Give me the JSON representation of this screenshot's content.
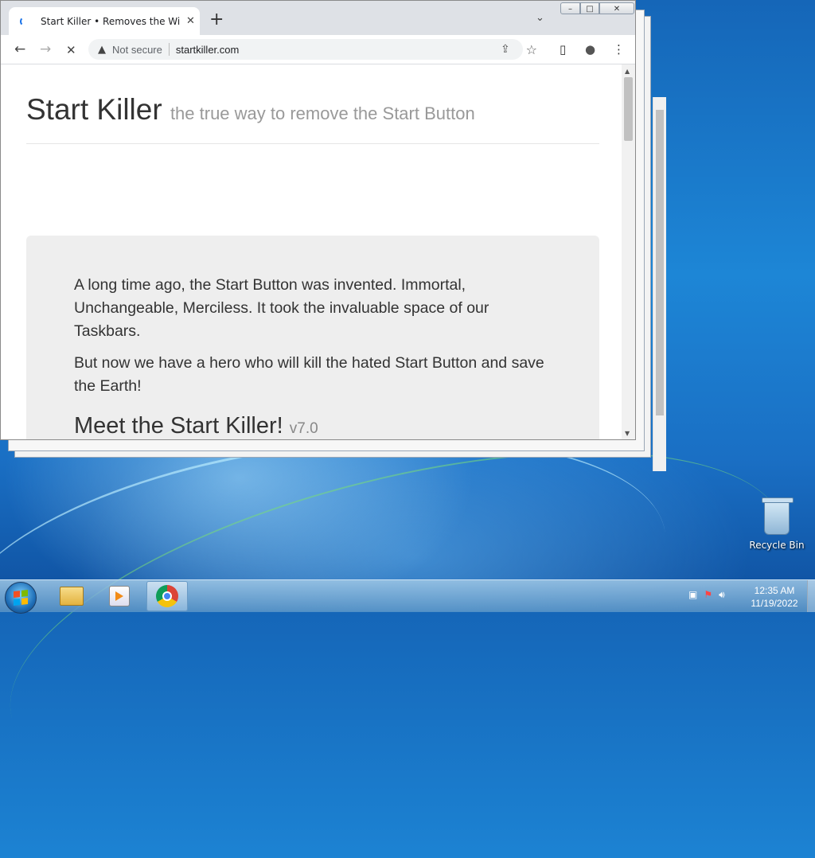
{
  "browser": {
    "tab_title": "Start Killer • Removes the Windows Start Button",
    "tab_close": "✕",
    "new_tab": "+",
    "tab_search": "⌄",
    "window_controls": {
      "minimize": "–",
      "maximize": "□",
      "close": "✕"
    },
    "nav": {
      "back": "←",
      "forward": "→",
      "reload": "✕"
    },
    "security_label": "Not secure",
    "url": "startkiller.com",
    "icons": {
      "share": "⇪",
      "star": "☆",
      "sidepanel": "▯",
      "profile": "●",
      "menu": "⋮"
    }
  },
  "page": {
    "title": "Start Killer",
    "tagline": "the true way to remove the Start Button",
    "paragraph1": "A long time ago, the Start Button was invented. Immortal, Unchangeable, Merciless. It took the invaluable space of our Taskbars.",
    "paragraph2": "But now we have a hero who will kill the hated Start Button and save the Earth!",
    "heading": "Meet the Start Killer!",
    "version": "v7.0"
  },
  "desktop": {
    "recycle_bin_label": "Recycle Bin"
  },
  "taskbar": {
    "clock_time": "12:35 AM",
    "clock_date": "11/19/2022",
    "tray_icons": [
      "network-icon",
      "flag-icon",
      "volume-icon"
    ]
  },
  "colors": {
    "tab_strip": "#dee1e6",
    "jumbotron": "#eeeeee",
    "chrome_blue": "#1a73e8"
  }
}
